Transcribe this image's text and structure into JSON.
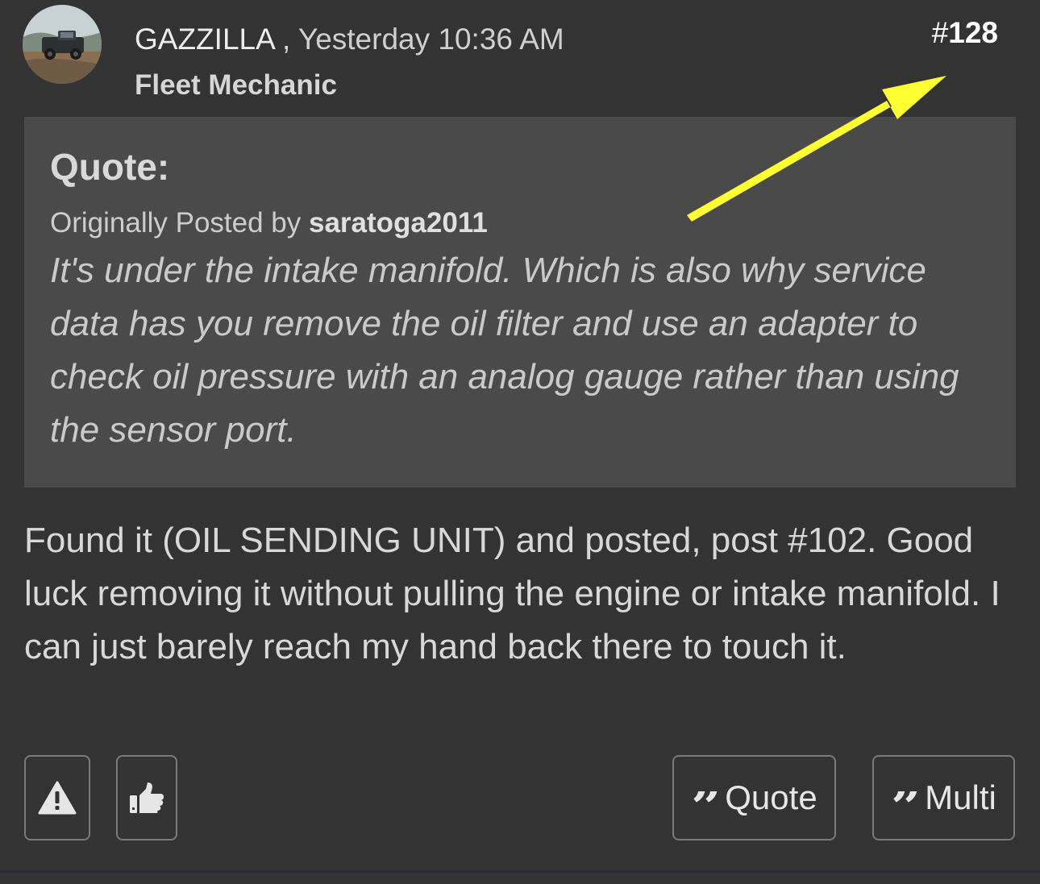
{
  "post": {
    "author": "GAZZILLA",
    "separator": ",",
    "timestamp": "Yesterday 10:36 AM",
    "user_title": "Fleet Mechanic",
    "number_prefix": "#",
    "number": "128"
  },
  "quote": {
    "heading": "Quote:",
    "attribution_prefix": "Originally Posted by",
    "quoted_user": "saratoga2011",
    "text": "It's under the intake manifold. Which is also why service data has you remove the oil filter and use an adapter to check oil pressure with an analog gauge rather than using the sensor port."
  },
  "message": "Found it (OIL SENDING UNIT) and posted, post #102. Good luck removing it without pulling the engine or intake manifold. I can just barely reach my hand back there to touch it.",
  "actions": {
    "report_icon": "warning-triangle-icon",
    "like_icon": "thumbs-up-icon",
    "quote_label": "Quote",
    "multi_label": "Multi",
    "quote_glyph": "”"
  },
  "annotation": {
    "arrow_color": "#ffff33"
  }
}
